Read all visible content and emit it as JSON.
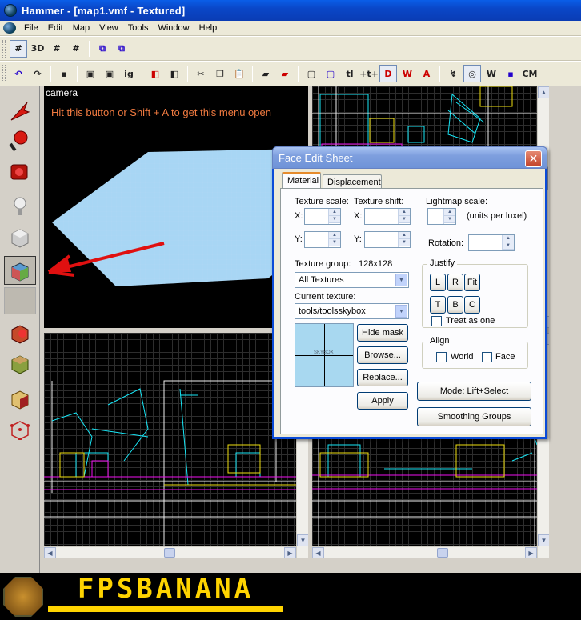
{
  "window": {
    "title": "Hammer - [map1.vmf - Textured]"
  },
  "menu": [
    "File",
    "Edit",
    "Map",
    "View",
    "Tools",
    "Window",
    "Help"
  ],
  "toolbar1": [
    {
      "name": "grid-toggle-icon",
      "glyph": "#"
    },
    {
      "name": "3d-grid-icon",
      "glyph": "3D"
    },
    {
      "name": "smaller-grid-icon",
      "glyph": "#"
    },
    {
      "name": "larger-grid-icon",
      "glyph": "#"
    },
    {
      "name": "carve-icon",
      "glyph": "⧉"
    },
    {
      "name": "group-icon",
      "glyph": "⧉"
    }
  ],
  "toolbar2": [
    {
      "name": "undo-icon",
      "glyph": "↶"
    },
    {
      "name": "redo-icon",
      "glyph": "↷"
    },
    {
      "name": "copy-paste-special-icon",
      "glyph": "▪"
    },
    {
      "name": "group-selection-icon",
      "glyph": "▣"
    },
    {
      "name": "ungroup-icon",
      "glyph": "▣"
    },
    {
      "name": "ignore-groups-icon",
      "glyph": "ig"
    },
    {
      "name": "hide-selected-icon",
      "glyph": "◧"
    },
    {
      "name": "show-all-icon",
      "glyph": "◧"
    },
    {
      "name": "cut-icon",
      "glyph": "✂"
    },
    {
      "name": "copy-icon",
      "glyph": "❐"
    },
    {
      "name": "paste-icon",
      "glyph": "📋"
    },
    {
      "name": "texture-lock-icon",
      "glyph": "▰"
    },
    {
      "name": "texture-scale-lock-icon",
      "glyph": "▰"
    },
    {
      "name": "selection-mode-icon",
      "glyph": "▢"
    },
    {
      "name": "select-all-icon",
      "glyph": "▢"
    },
    {
      "name": "tl-icon",
      "glyph": "tl"
    },
    {
      "name": "flip-icon",
      "glyph": "+t+"
    },
    {
      "name": "tie-to-entity-icon",
      "glyph": "D"
    },
    {
      "name": "move-to-world-icon",
      "glyph": "W"
    },
    {
      "name": "to-entity-icon",
      "glyph": "A"
    },
    {
      "name": "vertex-icon",
      "glyph": "↯"
    },
    {
      "name": "radar-icon",
      "glyph": "◎"
    },
    {
      "name": "cordon-icon",
      "glyph": "W"
    },
    {
      "name": "autoselect-icon",
      "glyph": "▪"
    },
    {
      "name": "cm-icon",
      "glyph": "CM"
    }
  ],
  "tools": [
    {
      "name": "selection-tool",
      "color": "#d81a12"
    },
    {
      "name": "magnify-tool",
      "color": "#d81a12"
    },
    {
      "name": "camera-tool",
      "color": "#b4140c"
    },
    {
      "name": "entity-tool",
      "color": "#eeeeee"
    },
    {
      "name": "block-tool",
      "color": "#cccccc"
    },
    {
      "name": "texture-application-tool",
      "color": "#5a9ad0"
    },
    {
      "name": "apply-current-texture-tool",
      "color": "#bdb9b0"
    },
    {
      "name": "decal-tool",
      "color": "#c44a2a"
    },
    {
      "name": "overlay-tool",
      "color": "#8aa040"
    },
    {
      "name": "clipping-tool",
      "color": "#e0c070"
    },
    {
      "name": "vertex-tool",
      "color": "#c02020"
    }
  ],
  "camera_view": {
    "label": "camera",
    "hint": "Hit this button or Shift + A to get this menu open"
  },
  "dialog": {
    "title": "Face Edit Sheet",
    "tabs": [
      "Material",
      "Displacement"
    ],
    "texture_scale_label": "Texture scale:",
    "texture_shift_label": "Texture shift:",
    "lightmap_scale_label": "Lightmap scale:",
    "lightmap_units": "(units per luxel)",
    "x_label": "X:",
    "y_label": "Y:",
    "rotation_label": "Rotation:",
    "texture_group_label": "Texture group:",
    "texture_size": "128x128",
    "texture_group_value": "All Textures",
    "current_texture_label": "Current texture:",
    "current_texture_value": "tools/toolsskybox",
    "preview_caption": "SKYBOX",
    "justify_label": "Justify",
    "justify_buttons": [
      "L",
      "R",
      "Fit",
      "T",
      "B",
      "C"
    ],
    "treat_as_one": "Treat as one",
    "align_label": "Align",
    "align_world": "World",
    "align_face": "Face",
    "hide_mask": "Hide mask",
    "browse": "Browse...",
    "replace": "Replace...",
    "apply": "Apply",
    "mode": "Mode: Lift+Select",
    "smoothing_groups": "Smoothing Groups"
  },
  "footer": {
    "logo_text": "FPSBANANA",
    "accent": "#ffd400"
  }
}
